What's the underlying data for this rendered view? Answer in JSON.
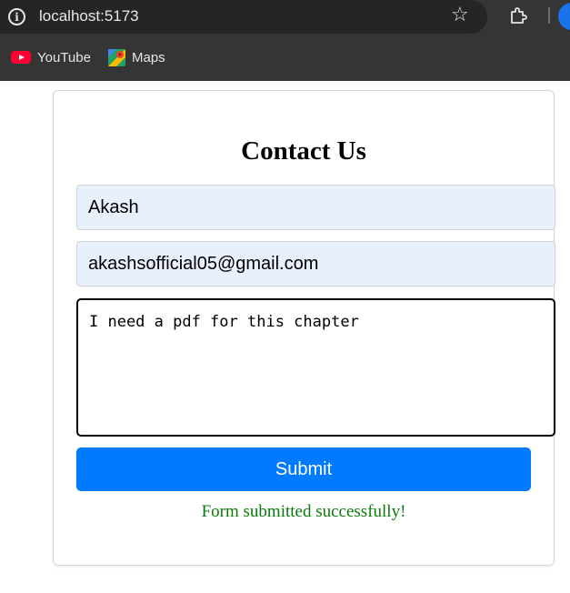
{
  "browser": {
    "url": "localhost:5173",
    "icons": {
      "info": "info-icon",
      "star": "star-icon",
      "extensions": "puzzle-icon"
    },
    "bookmarks": [
      {
        "label": "YouTube",
        "icon": "youtube-icon"
      },
      {
        "label": "Maps",
        "icon": "maps-icon"
      }
    ]
  },
  "form": {
    "title": "Contact Us",
    "name_value": "Akash",
    "email_value": "akashsofficial05@gmail.com",
    "message_value": "I need a pdf for this chapter",
    "submit_label": "Submit",
    "success_message": "Form submitted successfully!"
  },
  "colors": {
    "primary_button": "#007bff",
    "success_text": "#0a7a0a",
    "autofill_bg": "#e8f0fe"
  }
}
